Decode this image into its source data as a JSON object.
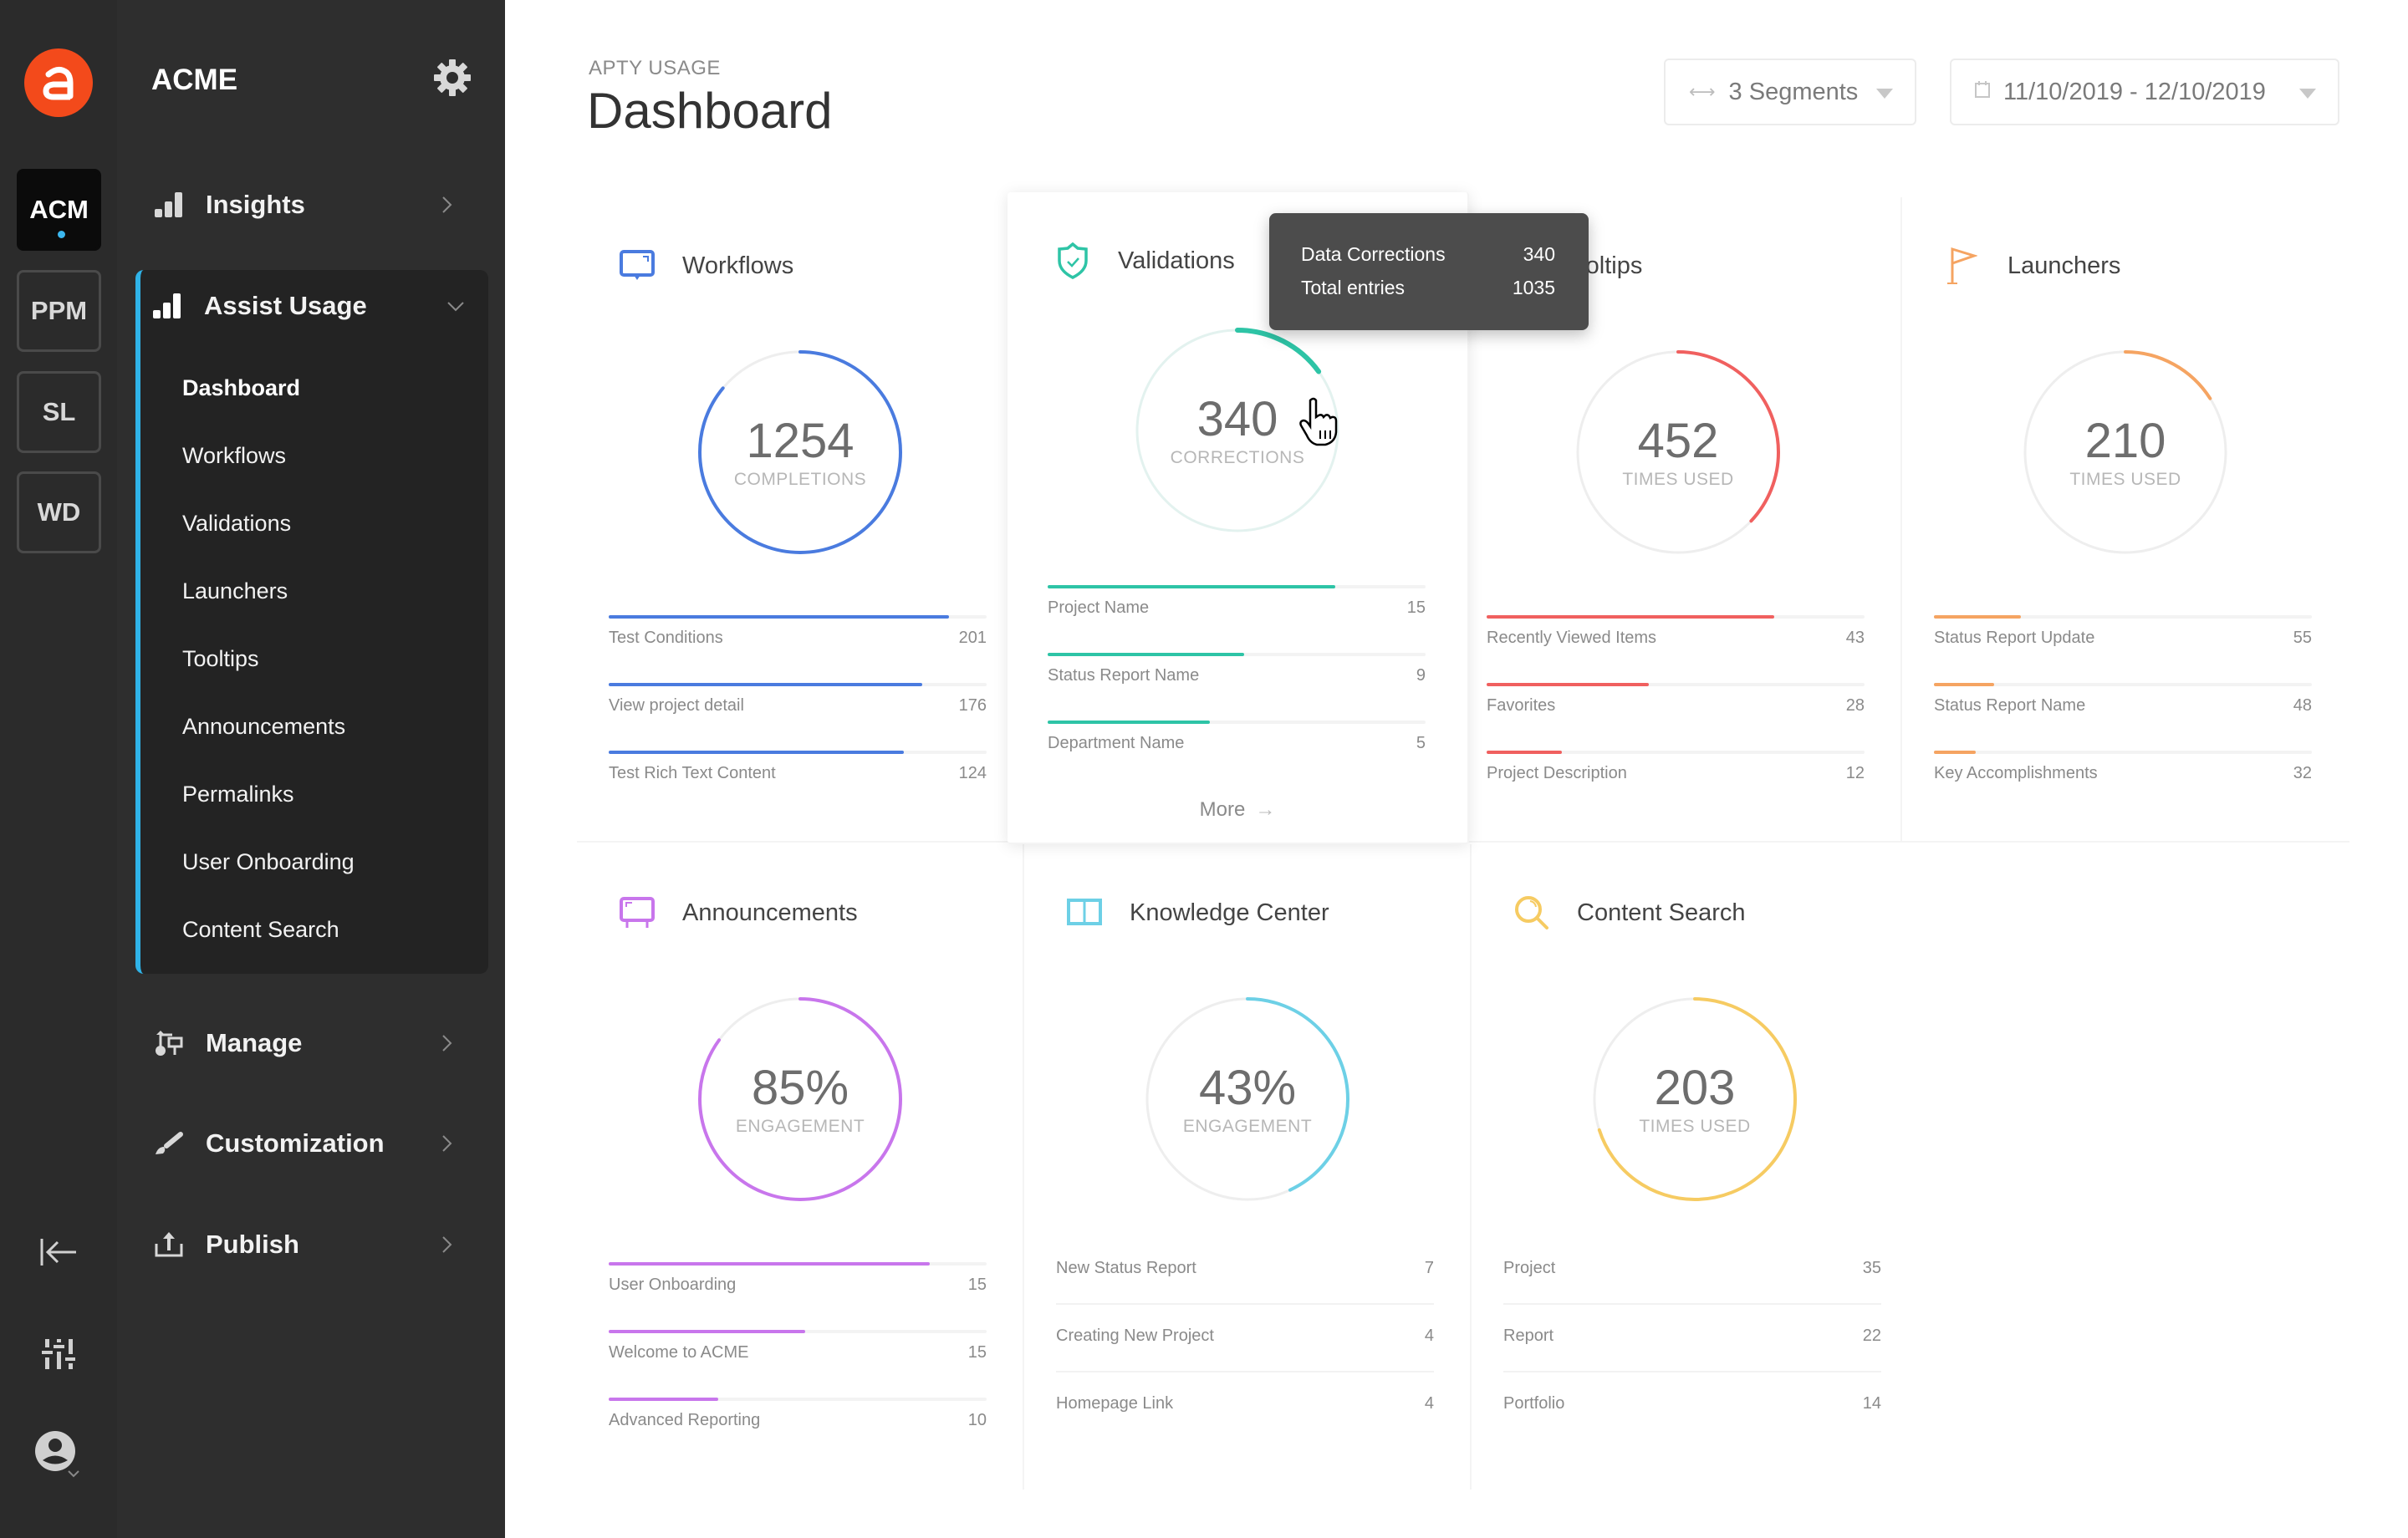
{
  "rail": {
    "logo_letter": "a",
    "workspaces": [
      {
        "label": "ACM",
        "active": true
      },
      {
        "label": "PPM",
        "active": false
      },
      {
        "label": "SL",
        "active": false
      },
      {
        "label": "WD",
        "active": false
      }
    ],
    "bottom_icons": [
      "collapse-icon",
      "sliders-icon",
      "user-account-icon"
    ]
  },
  "nav": {
    "brand": "ACME",
    "items": [
      {
        "label": "Insights",
        "icon": "bar-chart-icon",
        "expanded": false
      },
      {
        "label": "Assist Usage",
        "icon": "bar-chart-icon",
        "expanded": true
      },
      {
        "label": "Manage",
        "icon": "manage-icon",
        "expanded": false
      },
      {
        "label": "Customization",
        "icon": "brush-icon",
        "expanded": false
      },
      {
        "label": "Publish",
        "icon": "upload-icon",
        "expanded": false
      }
    ],
    "sub_items": [
      "Dashboard",
      "Workflows",
      "Validations",
      "Launchers",
      "Tooltips",
      "Announcements",
      "Permalinks",
      "User Onboarding",
      "Content Search"
    ],
    "active_sub": "Dashboard"
  },
  "header": {
    "eyebrow": "APTY USAGE",
    "title": "Dashboard",
    "segments": "3 Segments",
    "date_range": "11/10/2019 - 12/10/2019"
  },
  "tooltip": {
    "rows": [
      {
        "label": "Data Corrections",
        "value": "340"
      },
      {
        "label": "Total entries",
        "value": "1035"
      }
    ]
  },
  "cards": [
    {
      "title": "Workflows",
      "icon": "workflow-icon",
      "color": "#4a7bdf",
      "value": "1254",
      "caption": "COMPLETIONS",
      "progress": 0.86,
      "rows": [
        {
          "label": "Test Conditions",
          "value": "201",
          "fill": 0.9
        },
        {
          "label": "View project detail",
          "value": "176",
          "fill": 0.83
        },
        {
          "label": "Test Rich Text Content",
          "value": "124",
          "fill": 0.78
        }
      ]
    },
    {
      "title": "Validations",
      "icon": "shield-check-icon",
      "color": "#2ec4a6",
      "value": "340",
      "caption": "CORRECTIONS",
      "progress": 0.15,
      "more": "More",
      "rows": [
        {
          "label": "Project Name",
          "value": "15",
          "fill": 0.76
        },
        {
          "label": "Status Report Name",
          "value": "9",
          "fill": 0.52
        },
        {
          "label": "Department Name",
          "value": "5",
          "fill": 0.43
        }
      ]
    },
    {
      "title": "Tooltips",
      "icon": "tooltip-icon",
      "color": "#f0605f",
      "value": "452",
      "caption": "TIMES USED",
      "progress": 0.37,
      "rows": [
        {
          "label": "Recently Viewed Items",
          "value": "43",
          "fill": 0.76
        },
        {
          "label": "Favorites",
          "value": "28",
          "fill": 0.43
        },
        {
          "label": "Project Description",
          "value": "12",
          "fill": 0.2
        }
      ]
    },
    {
      "title": "Launchers",
      "icon": "flag-icon",
      "color": "#f5a462",
      "value": "210",
      "caption": "TIMES USED",
      "progress": 0.16,
      "rows": [
        {
          "label": "Status Report Update",
          "value": "55",
          "fill": 0.23
        },
        {
          "label": "Status Report Name",
          "value": "48",
          "fill": 0.16
        },
        {
          "label": "Key Accomplishments",
          "value": "32",
          "fill": 0.11
        }
      ]
    },
    {
      "title": "Announcements",
      "icon": "announcement-board-icon",
      "color": "#c876ec",
      "value": "85%",
      "caption": "ENGAGEMENT",
      "progress": 0.85,
      "rows": [
        {
          "label": "User Onboarding",
          "value": "15",
          "fill": 0.85
        },
        {
          "label": "Welcome to ACME",
          "value": "15",
          "fill": 0.52
        },
        {
          "label": "Advanced Reporting",
          "value": "10",
          "fill": 0.29
        }
      ]
    },
    {
      "title": "Knowledge Center",
      "icon": "book-icon",
      "color": "#6dd0e6",
      "value": "43%",
      "caption": "ENGAGEMENT",
      "progress": 0.43,
      "rows": [
        {
          "label": "New Status Report",
          "value": "7"
        },
        {
          "label": "Creating New Project",
          "value": "4"
        },
        {
          "label": "Homepage Link",
          "value": "4"
        }
      ]
    },
    {
      "title": "Content Search",
      "icon": "search-icon",
      "color": "#f6cb62",
      "value": "203",
      "caption": "TIMES USED",
      "progress": 0.7,
      "rows": [
        {
          "label": "Project",
          "value": "35"
        },
        {
          "label": "Report",
          "value": "22"
        },
        {
          "label": "Portfolio",
          "value": "14"
        }
      ]
    }
  ]
}
